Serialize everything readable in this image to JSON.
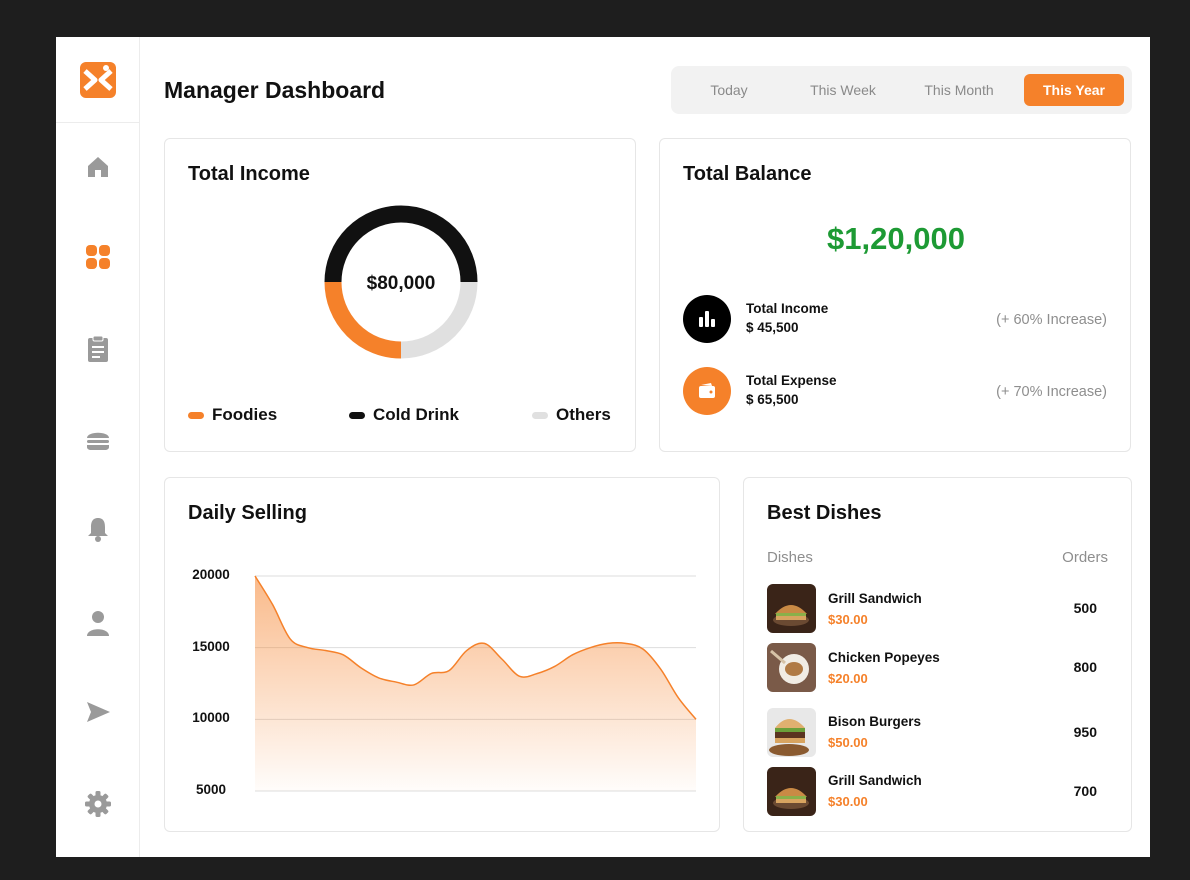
{
  "colors": {
    "accent": "#f5812a",
    "dark": "#111111",
    "light_gray": "#e0e0e0",
    "success": "#1d9a34"
  },
  "sidebar": {
    "logo": "logo-icon",
    "items": [
      {
        "icon": "home-icon"
      },
      {
        "icon": "grid-icon",
        "active": true
      },
      {
        "icon": "clipboard-icon"
      },
      {
        "icon": "burger-icon"
      },
      {
        "icon": "bell-icon"
      },
      {
        "icon": "user-icon"
      },
      {
        "icon": "send-icon"
      },
      {
        "icon": "gear-icon"
      }
    ]
  },
  "header": {
    "title": "Manager Dashboard",
    "tabs": [
      {
        "label": "Today"
      },
      {
        "label": "This Week"
      },
      {
        "label": "This Month"
      },
      {
        "label": "This Year",
        "active": true
      }
    ]
  },
  "income": {
    "title": "Total Income",
    "center_label": "$80,000",
    "legend": [
      {
        "label": "Foodies",
        "color": "#f5812a"
      },
      {
        "label": "Cold Drink",
        "color": "#111111"
      },
      {
        "label": "Others",
        "color": "#e0e0e0"
      }
    ]
  },
  "balance": {
    "title": "Total Balance",
    "amount": "$1,20,000",
    "items": [
      {
        "label": "Total Income",
        "value": "$ 45,500",
        "change": "(+ 60% Increase)",
        "icon": "bar-chart-icon"
      },
      {
        "label": "Total Expense",
        "value": "$ 65,500",
        "change": "(+ 70% Increase)",
        "icon": "wallet-icon"
      }
    ]
  },
  "daily": {
    "title": "Daily Selling"
  },
  "dishes": {
    "title": "Best Dishes",
    "col_dishes": "Dishes",
    "col_orders": "Orders",
    "items": [
      {
        "name": "Grill Sandwich",
        "price": "$30.00",
        "orders": "500",
        "image": "sandwich"
      },
      {
        "name": "Chicken Popeyes",
        "price": "$20.00",
        "orders": "800",
        "image": "chicken"
      },
      {
        "name": "Bison Burgers",
        "price": "$50.00",
        "orders": "950",
        "image": "burger"
      },
      {
        "name": "Grill Sandwich",
        "price": "$30.00",
        "orders": "700",
        "image": "sandwich"
      }
    ]
  },
  "chart_data": [
    {
      "type": "pie",
      "title": "Total Income",
      "categories": [
        "Foodies",
        "Cold Drink",
        "Others"
      ],
      "values": [
        25,
        50,
        25
      ],
      "center_label": "$80,000",
      "legend_position": "bottom"
    },
    {
      "type": "area",
      "title": "Daily Selling",
      "x": [
        0,
        1,
        2,
        3,
        4,
        5,
        6,
        7,
        8,
        9,
        10,
        11,
        12,
        13,
        14,
        15,
        16,
        17,
        18,
        19,
        20,
        21,
        22,
        23,
        24,
        25
      ],
      "series": [
        {
          "values": [
            20000,
            18000,
            15600,
            15000,
            14800,
            14500,
            13600,
            12900,
            12600,
            12400,
            13200,
            13400,
            14800,
            15300,
            14200,
            13000,
            13200,
            13700,
            14500,
            15000,
            15300,
            15300,
            14900,
            13500,
            11500,
            10000
          ]
        }
      ],
      "yticks": [
        20000,
        15000,
        10000,
        5000
      ],
      "ylim": [
        5000,
        20000
      ],
      "grid": true
    }
  ]
}
